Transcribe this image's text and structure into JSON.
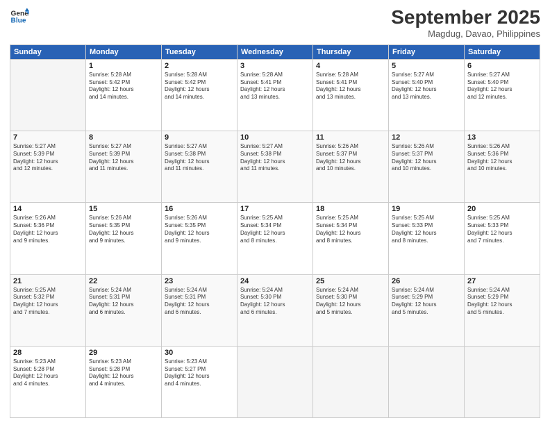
{
  "header": {
    "logo_line1": "General",
    "logo_line2": "Blue",
    "month_title": "September 2025",
    "location": "Magdug, Davao, Philippines"
  },
  "days_of_week": [
    "Sunday",
    "Monday",
    "Tuesday",
    "Wednesday",
    "Thursday",
    "Friday",
    "Saturday"
  ],
  "weeks": [
    [
      {
        "day": "",
        "info": ""
      },
      {
        "day": "1",
        "info": "Sunrise: 5:28 AM\nSunset: 5:42 PM\nDaylight: 12 hours\nand 14 minutes."
      },
      {
        "day": "2",
        "info": "Sunrise: 5:28 AM\nSunset: 5:42 PM\nDaylight: 12 hours\nand 14 minutes."
      },
      {
        "day": "3",
        "info": "Sunrise: 5:28 AM\nSunset: 5:41 PM\nDaylight: 12 hours\nand 13 minutes."
      },
      {
        "day": "4",
        "info": "Sunrise: 5:28 AM\nSunset: 5:41 PM\nDaylight: 12 hours\nand 13 minutes."
      },
      {
        "day": "5",
        "info": "Sunrise: 5:27 AM\nSunset: 5:40 PM\nDaylight: 12 hours\nand 13 minutes."
      },
      {
        "day": "6",
        "info": "Sunrise: 5:27 AM\nSunset: 5:40 PM\nDaylight: 12 hours\nand 12 minutes."
      }
    ],
    [
      {
        "day": "7",
        "info": "Sunrise: 5:27 AM\nSunset: 5:39 PM\nDaylight: 12 hours\nand 12 minutes."
      },
      {
        "day": "8",
        "info": "Sunrise: 5:27 AM\nSunset: 5:39 PM\nDaylight: 12 hours\nand 11 minutes."
      },
      {
        "day": "9",
        "info": "Sunrise: 5:27 AM\nSunset: 5:38 PM\nDaylight: 12 hours\nand 11 minutes."
      },
      {
        "day": "10",
        "info": "Sunrise: 5:27 AM\nSunset: 5:38 PM\nDaylight: 12 hours\nand 11 minutes."
      },
      {
        "day": "11",
        "info": "Sunrise: 5:26 AM\nSunset: 5:37 PM\nDaylight: 12 hours\nand 10 minutes."
      },
      {
        "day": "12",
        "info": "Sunrise: 5:26 AM\nSunset: 5:37 PM\nDaylight: 12 hours\nand 10 minutes."
      },
      {
        "day": "13",
        "info": "Sunrise: 5:26 AM\nSunset: 5:36 PM\nDaylight: 12 hours\nand 10 minutes."
      }
    ],
    [
      {
        "day": "14",
        "info": "Sunrise: 5:26 AM\nSunset: 5:36 PM\nDaylight: 12 hours\nand 9 minutes."
      },
      {
        "day": "15",
        "info": "Sunrise: 5:26 AM\nSunset: 5:35 PM\nDaylight: 12 hours\nand 9 minutes."
      },
      {
        "day": "16",
        "info": "Sunrise: 5:26 AM\nSunset: 5:35 PM\nDaylight: 12 hours\nand 9 minutes."
      },
      {
        "day": "17",
        "info": "Sunrise: 5:25 AM\nSunset: 5:34 PM\nDaylight: 12 hours\nand 8 minutes."
      },
      {
        "day": "18",
        "info": "Sunrise: 5:25 AM\nSunset: 5:34 PM\nDaylight: 12 hours\nand 8 minutes."
      },
      {
        "day": "19",
        "info": "Sunrise: 5:25 AM\nSunset: 5:33 PM\nDaylight: 12 hours\nand 8 minutes."
      },
      {
        "day": "20",
        "info": "Sunrise: 5:25 AM\nSunset: 5:33 PM\nDaylight: 12 hours\nand 7 minutes."
      }
    ],
    [
      {
        "day": "21",
        "info": "Sunrise: 5:25 AM\nSunset: 5:32 PM\nDaylight: 12 hours\nand 7 minutes."
      },
      {
        "day": "22",
        "info": "Sunrise: 5:24 AM\nSunset: 5:31 PM\nDaylight: 12 hours\nand 6 minutes."
      },
      {
        "day": "23",
        "info": "Sunrise: 5:24 AM\nSunset: 5:31 PM\nDaylight: 12 hours\nand 6 minutes."
      },
      {
        "day": "24",
        "info": "Sunrise: 5:24 AM\nSunset: 5:30 PM\nDaylight: 12 hours\nand 6 minutes."
      },
      {
        "day": "25",
        "info": "Sunrise: 5:24 AM\nSunset: 5:30 PM\nDaylight: 12 hours\nand 5 minutes."
      },
      {
        "day": "26",
        "info": "Sunrise: 5:24 AM\nSunset: 5:29 PM\nDaylight: 12 hours\nand 5 minutes."
      },
      {
        "day": "27",
        "info": "Sunrise: 5:24 AM\nSunset: 5:29 PM\nDaylight: 12 hours\nand 5 minutes."
      }
    ],
    [
      {
        "day": "28",
        "info": "Sunrise: 5:23 AM\nSunset: 5:28 PM\nDaylight: 12 hours\nand 4 minutes."
      },
      {
        "day": "29",
        "info": "Sunrise: 5:23 AM\nSunset: 5:28 PM\nDaylight: 12 hours\nand 4 minutes."
      },
      {
        "day": "30",
        "info": "Sunrise: 5:23 AM\nSunset: 5:27 PM\nDaylight: 12 hours\nand 4 minutes."
      },
      {
        "day": "",
        "info": ""
      },
      {
        "day": "",
        "info": ""
      },
      {
        "day": "",
        "info": ""
      },
      {
        "day": "",
        "info": ""
      }
    ]
  ]
}
